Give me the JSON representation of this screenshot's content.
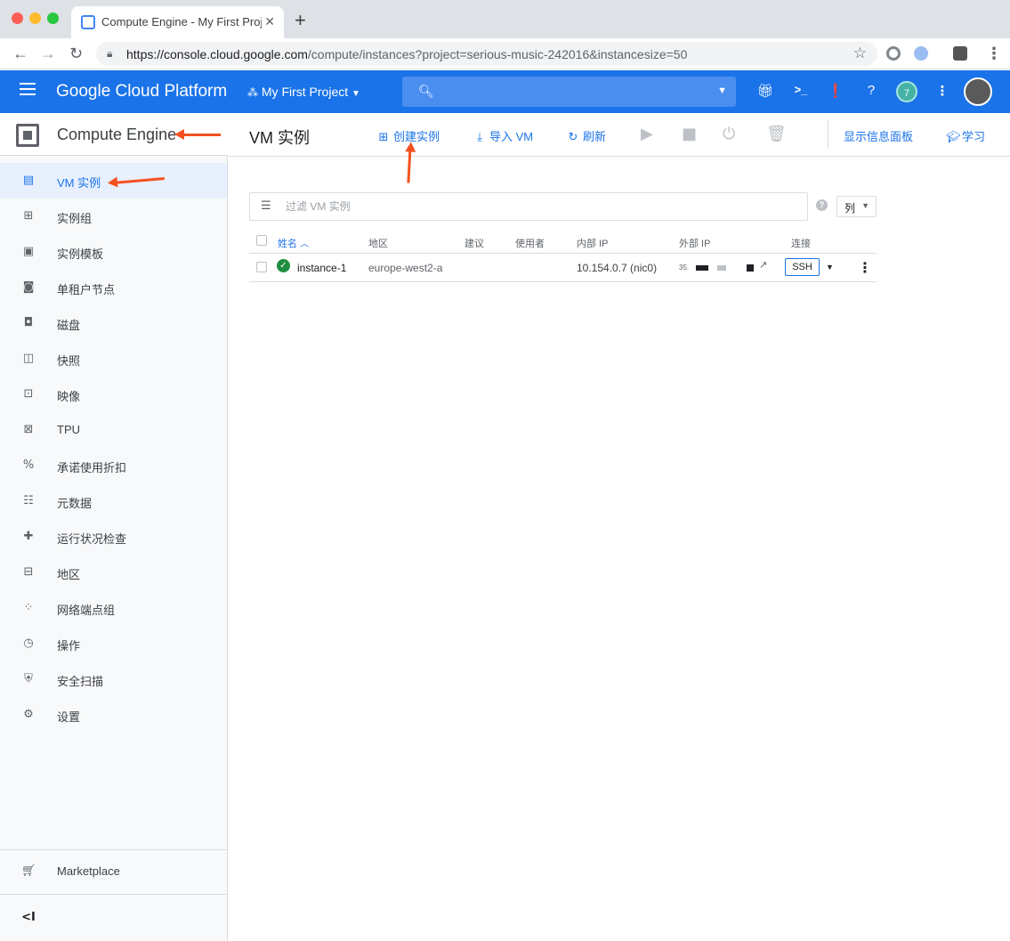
{
  "browser": {
    "tab_title": "Compute Engine - My First Proj",
    "new_tab": "+",
    "url_host": "https://console.cloud.google.com",
    "url_path": "/compute/instances?project=serious-music-242016&instancesize=50"
  },
  "header": {
    "brand": "Google Cloud Platform",
    "project": "My First Project",
    "notification_count": "7"
  },
  "sidebar": {
    "product": "Compute Engine",
    "items": [
      {
        "label": "VM 实例",
        "icon": "vm-instance-icon",
        "active": true
      },
      {
        "label": "实例组",
        "icon": "instance-group-icon"
      },
      {
        "label": "实例模板",
        "icon": "template-icon"
      },
      {
        "label": "单租户节点",
        "icon": "sole-tenant-icon"
      },
      {
        "label": "磁盘",
        "icon": "disk-icon"
      },
      {
        "label": "快照",
        "icon": "snapshot-icon"
      },
      {
        "label": "映像",
        "icon": "image-icon"
      },
      {
        "label": "TPU",
        "icon": "tpu-icon"
      },
      {
        "label": "承诺使用折扣",
        "icon": "percent-icon"
      },
      {
        "label": "元数据",
        "icon": "metadata-icon"
      },
      {
        "label": "运行状况检查",
        "icon": "health-check-icon"
      },
      {
        "label": "地区",
        "icon": "zone-icon"
      },
      {
        "label": "网络端点组",
        "icon": "network-endpoint-icon"
      },
      {
        "label": "操作",
        "icon": "clock-icon"
      },
      {
        "label": "安全扫描",
        "icon": "shield-icon"
      },
      {
        "label": "设置",
        "icon": "gear-icon"
      }
    ],
    "marketplace": "Marketplace",
    "collapse": "<I"
  },
  "toolbar": {
    "page_title": "VM 实例",
    "create_instance": "创建实例",
    "import_vm": "导入 VM",
    "refresh": "刷新",
    "show_info_panel": "显示信息面板",
    "learn": "学习"
  },
  "filter": {
    "placeholder": "过滤 VM 实例",
    "columns_label": "列"
  },
  "table": {
    "headers": {
      "name": "姓名",
      "zone": "地区",
      "recommendation": "建议",
      "in_use_by": "使用者",
      "internal_ip": "内部 IP",
      "external_ip": "外部 IP",
      "connect": "连接"
    },
    "rows": [
      {
        "name": "instance-1",
        "zone": "europe-west2-a",
        "internal_ip": "10.154.0.7 (nic0)",
        "external_ip": "35.",
        "connect": "SSH"
      }
    ]
  },
  "colors": {
    "accent": "#1a73e8",
    "annotation_arrow": "#f4511e",
    "status_ok": "#1e8e3e"
  }
}
